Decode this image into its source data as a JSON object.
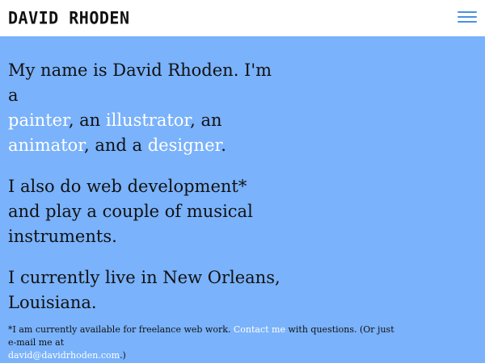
{
  "header": {
    "logo_text": "DAVID RHODEN",
    "menu_icon": "hamburger-menu-icon"
  },
  "intro": {
    "line_a": "My name is David Rhoden. I'm a",
    "painter": "painter",
    "sep1": ", an ",
    "illustrator": "illustrator",
    "sep2": ", an",
    "animator": "animator",
    "sep3": ", and a ",
    "designer": "designer",
    "end": "."
  },
  "paragraph2": "I also do web development* and play a couple of musical instruments.",
  "paragraph3": "I currently live in New Orleans, Louisiana.",
  "footnote": {
    "before_contact": "*I am currently available for freelance web work. ",
    "contact_label": "Contact me",
    "after_contact": " with questions. (Or just e-mail me at ",
    "email": "david@davidrhoden.com",
    "end": ".)"
  },
  "colors": {
    "background": "#7ab2fb",
    "header_bg": "#ffffff",
    "link": "#ffffff",
    "menu_icon": "#4a90e2"
  }
}
